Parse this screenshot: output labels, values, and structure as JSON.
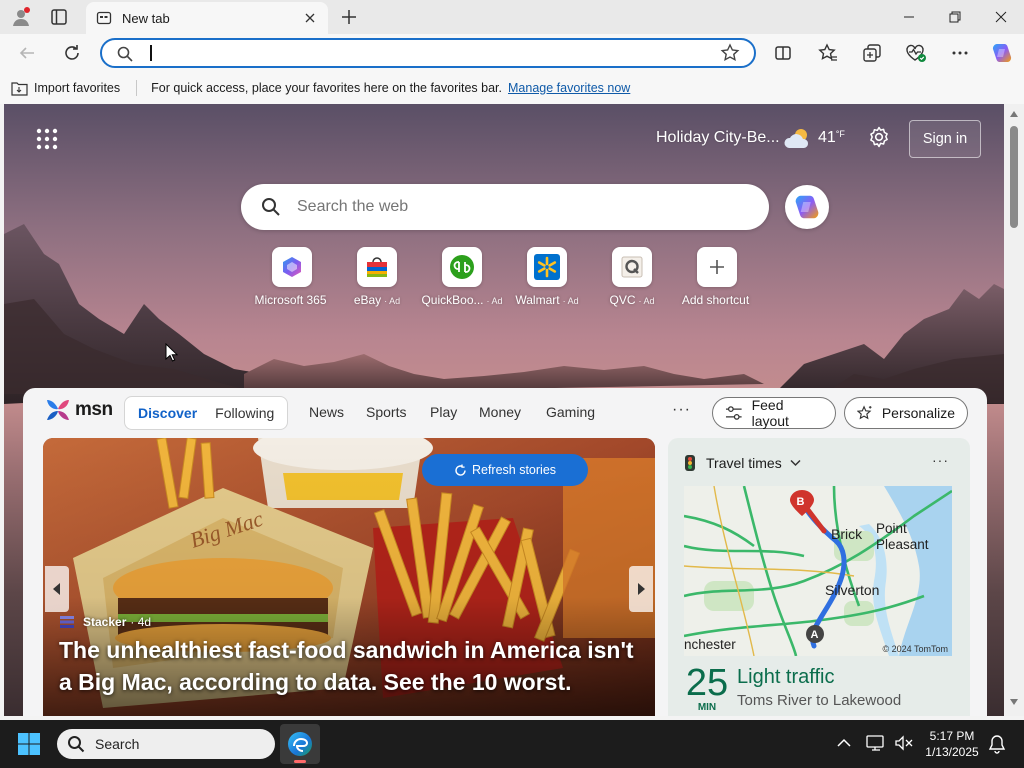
{
  "browser": {
    "tab": {
      "title": "New tab"
    },
    "address_bar": {
      "value": "",
      "placeholder": ""
    }
  },
  "favorites_bar": {
    "import_label": "Import favorites",
    "hint": "For quick access, place your favorites here on the favorites bar.",
    "manage_link": "Manage favorites now"
  },
  "newtab": {
    "location": "Holiday City-Be...",
    "temperature": "41",
    "temperature_unit": "°F",
    "signin_label": "Sign in",
    "search_placeholder": "Search the web",
    "shortcuts": [
      {
        "label": "Microsoft 365",
        "ad": "",
        "icon": "microsoft-365-icon"
      },
      {
        "label": "eBay",
        "ad": "· Ad",
        "icon": "ebay-bag-icon"
      },
      {
        "label": "QuickBoo...",
        "ad": "· Ad",
        "icon": "quickbooks-icon"
      },
      {
        "label": "Walmart",
        "ad": "· Ad",
        "icon": "walmart-spark-icon"
      },
      {
        "label": "QVC",
        "ad": "· Ad",
        "icon": "qvc-icon"
      },
      {
        "label": "Add shortcut",
        "ad": "",
        "icon": "plus-icon"
      }
    ]
  },
  "feed": {
    "brand": "msn",
    "pill_tabs": [
      "Discover",
      "Following"
    ],
    "nav_tabs": [
      "News",
      "Sports",
      "Play",
      "Money",
      "Gaming"
    ],
    "more": "···",
    "feed_layout_label": "Feed layout",
    "personalize_label": "Personalize",
    "hero": {
      "refresh_label": "Refresh stories",
      "source": "Stacker",
      "age": "· 4d",
      "headline": "The unhealthiest fast-food sandwich in America isn't a Big Mac, according to data. See the 10 worst."
    },
    "travel": {
      "title": "Travel times",
      "more": "···",
      "map_labels": [
        "Brick",
        "Point Pleasant",
        "Silverton",
        "nchester"
      ],
      "map_credit": "© 2024 TomTom",
      "minutes": "25",
      "minutes_unit": "MIN",
      "status": "Light traffic",
      "route": "Toms River to Lakewood"
    }
  },
  "taskbar": {
    "search_label": "Search",
    "time": "5:17 PM",
    "date": "1/13/2025"
  },
  "colors": {
    "accent_blue": "#1a6fd4",
    "traffic_green": "#0b6d4c",
    "route_blue": "#2f6fe0"
  }
}
